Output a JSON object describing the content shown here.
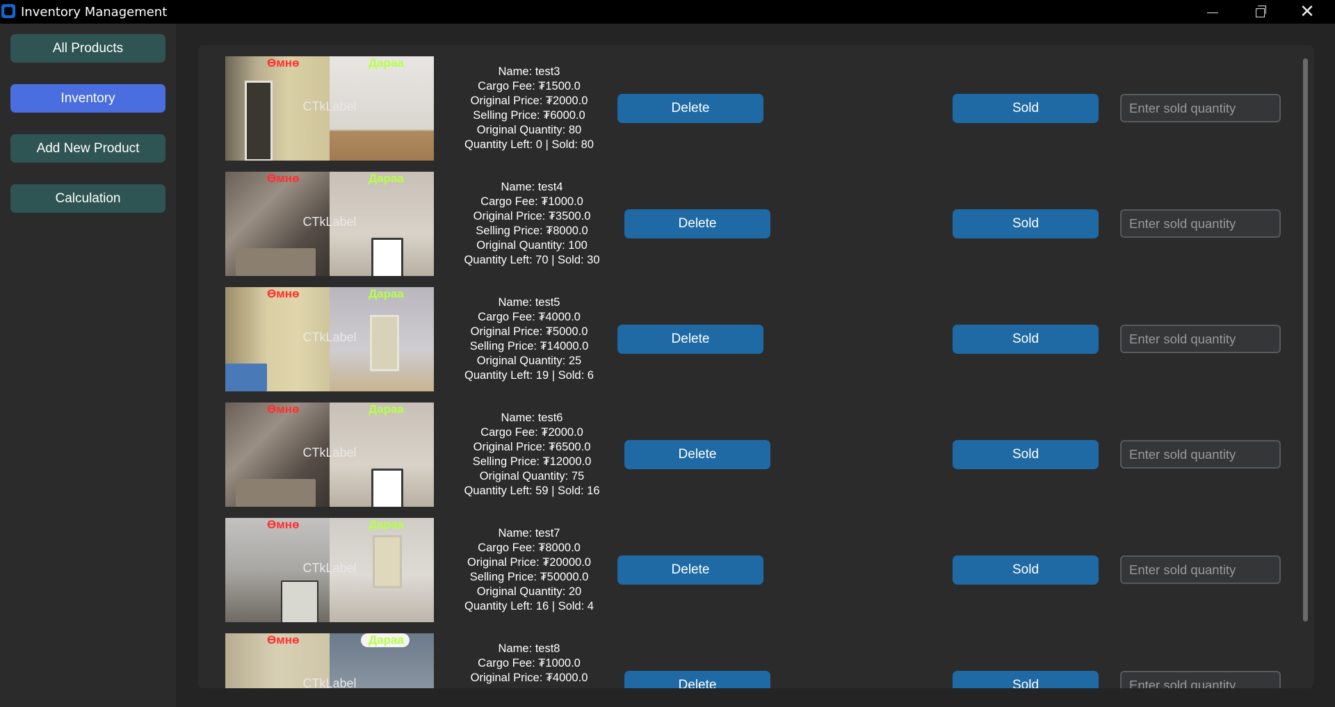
{
  "window": {
    "title": "Inventory Management"
  },
  "sidebar": {
    "items": [
      {
        "label": "All Products"
      },
      {
        "label": "Inventory"
      },
      {
        "label": "Add New Product"
      },
      {
        "label": "Calculation"
      }
    ],
    "active_index": 1
  },
  "colors": {
    "nav_button": "#2e5553",
    "nav_active": "#4a6ee0",
    "action_button": "#1f6aa5",
    "before_label": "#ff3030",
    "after_label": "#b6ff4a"
  },
  "labels": {
    "before": "Өмнө",
    "after": "Дараа",
    "image_placeholder": "CTkLabel",
    "delete": "Delete",
    "sold": "Sold",
    "qty_placeholder": "Enter sold quantity"
  },
  "products": [
    {
      "name": "Name: test3",
      "cargo": "Cargo Fee: ₮1500.0",
      "original_price": "Original Price: ₮2000.0",
      "selling_price": "Selling Price: ₮6000.0",
      "original_qty": "Original Quantity: 80",
      "left_sold": "Quantity Left: 0 | Sold: 80"
    },
    {
      "name": "Name: test4",
      "cargo": "Cargo Fee: ₮1000.0",
      "original_price": "Original Price: ₮3500.0",
      "selling_price": "Selling Price: ₮8000.0",
      "original_qty": "Original Quantity: 100",
      "left_sold": "Quantity Left: 70 | Sold: 30"
    },
    {
      "name": "Name: test5",
      "cargo": "Cargo Fee: ₮4000.0",
      "original_price": "Original Price: ₮5000.0",
      "selling_price": "Selling Price: ₮14000.0",
      "original_qty": "Original Quantity: 25",
      "left_sold": "Quantity Left: 19 | Sold: 6"
    },
    {
      "name": "Name: test6",
      "cargo": "Cargo Fee: ₮2000.0",
      "original_price": "Original Price: ₮6500.0",
      "selling_price": "Selling Price: ₮12000.0",
      "original_qty": "Original Quantity: 75",
      "left_sold": "Quantity Left: 59 | Sold: 16"
    },
    {
      "name": "Name: test7",
      "cargo": "Cargo Fee: ₮8000.0",
      "original_price": "Original Price: ₮20000.0",
      "selling_price": "Selling Price: ₮50000.0",
      "original_qty": "Original Quantity: 20",
      "left_sold": "Quantity Left: 16 | Sold: 4"
    },
    {
      "name": "Name: test8",
      "cargo": "Cargo Fee: ₮1000.0",
      "original_price": "Original Price: ₮4000.0",
      "selling_price": "",
      "original_qty": "",
      "left_sold": ""
    }
  ]
}
